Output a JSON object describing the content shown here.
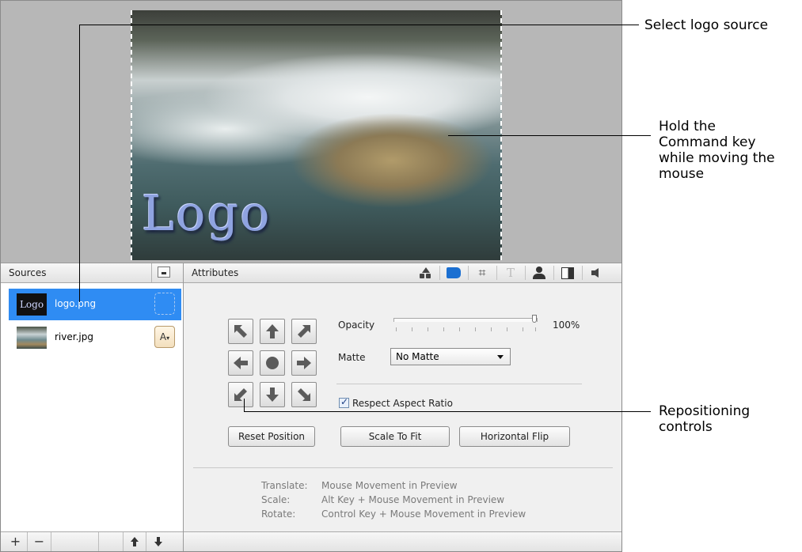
{
  "preview": {
    "logo_text": "Logo"
  },
  "sources": {
    "header": "Sources",
    "items": [
      {
        "thumb": "Logo",
        "name": "logo.png"
      },
      {
        "name": "river.jpg"
      }
    ],
    "anchor_button_label": "A",
    "footer": {
      "add": "+",
      "remove": "−",
      "move_up": "🡅",
      "move_down": "🡇"
    }
  },
  "attributes": {
    "header": "Attributes",
    "tabs": [
      "shapes-icon",
      "position-icon",
      "crop-icon",
      "text-icon",
      "person-icon",
      "split-icon",
      "audio-icon"
    ],
    "opacity_label": "Opacity",
    "opacity_value": "100%",
    "opacity_fraction": 1.0,
    "matte_label": "Matte",
    "matte_value": "No Matte",
    "respect_aspect_label": "Respect Aspect Ratio",
    "respect_aspect_checked": true,
    "buttons": {
      "reset": "Reset Position",
      "scale": "Scale To Fit",
      "flip": "Horizontal Flip"
    },
    "help": [
      {
        "key": "Translate:",
        "desc": "Mouse Movement in Preview"
      },
      {
        "key": "Scale:",
        "desc": "Alt Key + Mouse Movement in Preview"
      },
      {
        "key": "Rotate:",
        "desc": "Control Key + Mouse Movement in Preview"
      }
    ]
  },
  "callouts": {
    "logo_source": "Select logo source",
    "command_key": [
      "Hold the",
      "Command key",
      "while moving the",
      "mouse"
    ],
    "repositioning": [
      "Repositioning",
      "controls"
    ]
  }
}
